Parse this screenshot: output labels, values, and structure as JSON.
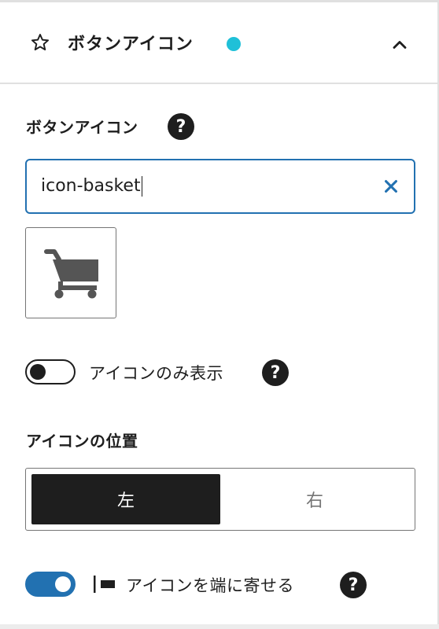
{
  "panel": {
    "title": "ボタンアイコン",
    "star_icon": "star-outline-icon",
    "status_dot_color": "#1fc0d8",
    "collapse_icon": "chevron-up-icon"
  },
  "icon_field": {
    "label": "ボタンアイコン",
    "help": "?",
    "value": "icon-basket",
    "clear_icon": "close-icon",
    "preview_icon": "shopping-cart-icon"
  },
  "icon_only": {
    "label": "アイコンのみ表示",
    "enabled": false,
    "help": "?"
  },
  "icon_position": {
    "label": "アイコンの位置",
    "options": [
      "左",
      "右"
    ],
    "selected": "左"
  },
  "edge_align": {
    "label": "アイコンを端に寄せる",
    "enabled": true,
    "help": "?",
    "icon": "align-edge-icon"
  },
  "colors": {
    "accent": "#2271b1",
    "text": "#1e1e1e",
    "border": "#757575"
  }
}
